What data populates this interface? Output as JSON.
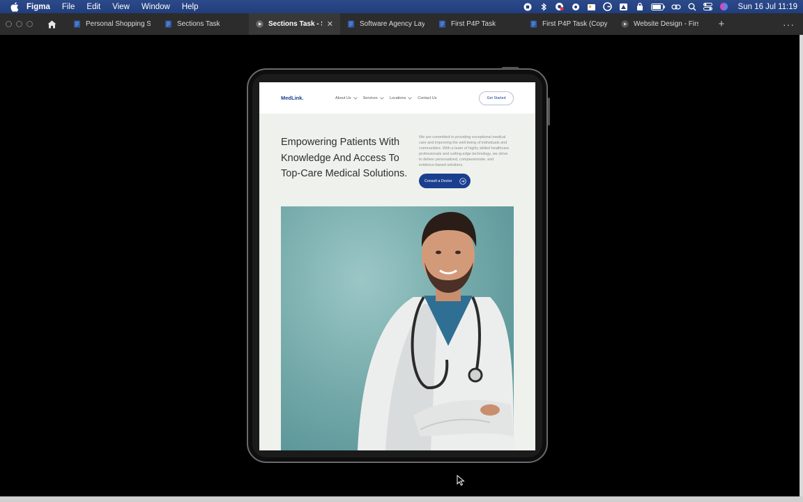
{
  "menubar": {
    "app_name": "Figma",
    "items": [
      "File",
      "Edit",
      "View",
      "Window",
      "Help"
    ],
    "clock": "Sun 16 Jul  11:19",
    "status_icons": [
      "record-icon",
      "bluetooth-icon",
      "chrome-icon",
      "cloud-icon",
      "puzzle-icon",
      "grammarly-icon",
      "drive-icon",
      "lock-icon",
      "battery-icon",
      "link-icon",
      "search-icon",
      "control-center-icon",
      "siri-icon"
    ]
  },
  "tabs": [
    {
      "label": "Personal Shopping S",
      "active": false,
      "icon": "figma-file-icon"
    },
    {
      "label": "Sections Task",
      "active": false,
      "icon": "figma-file-icon"
    },
    {
      "label": "Sections Task - Se",
      "active": true,
      "icon": "play-icon"
    },
    {
      "label": "Software Agency Lay",
      "active": false,
      "icon": "figma-file-icon"
    },
    {
      "label": "First P4P Task",
      "active": false,
      "icon": "figma-file-icon"
    },
    {
      "label": "First P4P Task (Copy",
      "active": false,
      "icon": "figma-file-icon"
    },
    {
      "label": "Website Design - Firs",
      "active": false,
      "icon": "play-icon"
    }
  ],
  "tabbar": {
    "plus": "+",
    "more": "···"
  },
  "website": {
    "logo": "MedLink.",
    "nav": [
      {
        "label": "About Us",
        "dropdown": true
      },
      {
        "label": "Services",
        "dropdown": true
      },
      {
        "label": "Locations",
        "dropdown": true
      },
      {
        "label": "Contact Us",
        "dropdown": false
      }
    ],
    "get_started": "Get Started",
    "headline": "Empowering Patients With Knowledge And Access To Top-Care Medical Solutions.",
    "intro": "We are committed to providing exceptional medical care and improving the well-being of individuals and communities. With a team of highly skilled healthcare professionals and cutting-edge technology, we strive to deliver personalized, compassionate, and evidence-based solutions.",
    "cta": "Consult a Doctor",
    "brand_color": "#1b3f8f"
  }
}
